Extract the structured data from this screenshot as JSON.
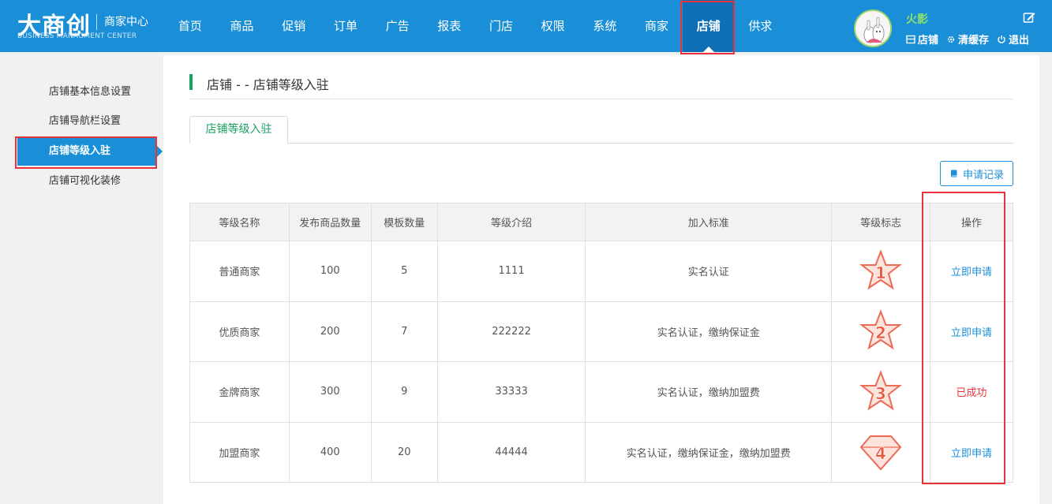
{
  "header": {
    "logo_main": "大商创",
    "logo_sub": "商家中心",
    "logo_en": "BUSINESS MANAGMENT CENTER",
    "nav": [
      "首页",
      "商品",
      "促销",
      "订单",
      "广告",
      "报表",
      "门店",
      "权限",
      "系统",
      "商家",
      "店铺",
      "供求"
    ],
    "active_nav": "店铺",
    "user": {
      "name": "火影",
      "links": {
        "shop": "店铺",
        "clear_cache": "清缓存",
        "logout": "退出"
      }
    }
  },
  "sidebar": {
    "items": [
      "店铺基本信息设置",
      "店铺导航栏设置",
      "店铺等级入驻",
      "店铺可视化装修"
    ],
    "active": "店铺等级入驻"
  },
  "main": {
    "title": "店铺 - - 店铺等级入驻",
    "tab": "店铺等级入驻",
    "record_button": "申请记录",
    "table": {
      "headers": [
        "等级名称",
        "发布商品数量",
        "模板数量",
        "等级介绍",
        "加入标准",
        "等级标志",
        "操作"
      ],
      "rows": [
        {
          "name": "普通商家",
          "goods": "100",
          "templates": "5",
          "intro": "1111",
          "standard": "实名认证",
          "badge": "1",
          "badge_shape": "star",
          "action": "立即申请",
          "action_status": "link"
        },
        {
          "name": "优质商家",
          "goods": "200",
          "templates": "7",
          "intro": "222222",
          "standard": "实名认证，缴纳保证金",
          "badge": "2",
          "badge_shape": "star",
          "action": "立即申请",
          "action_status": "link"
        },
        {
          "name": "金牌商家",
          "goods": "300",
          "templates": "9",
          "intro": "33333",
          "standard": "实名认证，缴纳加盟费",
          "badge": "3",
          "badge_shape": "star",
          "action": "已成功",
          "action_status": "done"
        },
        {
          "name": "加盟商家",
          "goods": "400",
          "templates": "20",
          "intro": "44444",
          "standard": "实名认证，缴纳保证金，缴纳加盟费",
          "badge": "4",
          "badge_shape": "diamond",
          "action": "立即申请",
          "action_status": "link"
        }
      ]
    }
  },
  "colors": {
    "header_bg": "#1a8fd8",
    "active_nav_bg": "#0e6fb7",
    "highlight_red": "#e8333a",
    "title_accent": "#1aa060",
    "link_blue": "#1a8fd8",
    "badge_fill": "#fde3dc",
    "badge_stroke": "#ec6b55"
  }
}
